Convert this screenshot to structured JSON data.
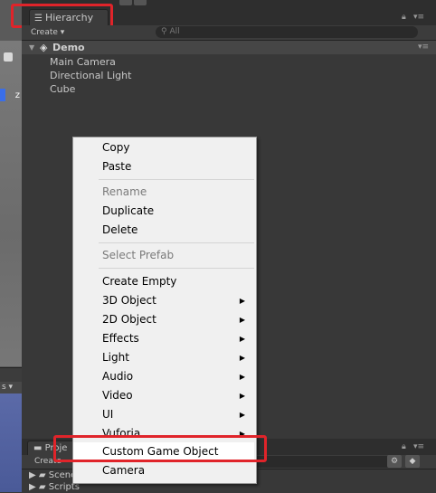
{
  "hierarchy": {
    "tab_label": "Hierarchy",
    "create_label": "Create ▾",
    "search_placeholder": "All",
    "scene_name": "Demo",
    "objects": [
      "Main Camera",
      "Directional Light",
      "Cube"
    ]
  },
  "scene_view": {
    "axis_label": "z",
    "side_label": "s ▾"
  },
  "context_menu": {
    "items": [
      {
        "label": "Copy",
        "enabled": true,
        "submenu": false
      },
      {
        "label": "Paste",
        "enabled": true,
        "submenu": false
      },
      {
        "label": "Rename",
        "enabled": false,
        "submenu": false
      },
      {
        "label": "Duplicate",
        "enabled": true,
        "submenu": false
      },
      {
        "label": "Delete",
        "enabled": true,
        "submenu": false
      },
      {
        "label": "Select Prefab",
        "enabled": false,
        "submenu": false
      },
      {
        "label": "Create Empty",
        "enabled": true,
        "submenu": false
      },
      {
        "label": "3D Object",
        "enabled": true,
        "submenu": true
      },
      {
        "label": "2D Object",
        "enabled": true,
        "submenu": true
      },
      {
        "label": "Effects",
        "enabled": true,
        "submenu": true
      },
      {
        "label": "Light",
        "enabled": true,
        "submenu": true
      },
      {
        "label": "Audio",
        "enabled": true,
        "submenu": true
      },
      {
        "label": "Video",
        "enabled": true,
        "submenu": true
      },
      {
        "label": "UI",
        "enabled": true,
        "submenu": true
      },
      {
        "label": "Vuforia",
        "enabled": true,
        "submenu": true
      },
      {
        "label": "Custom Game Object",
        "enabled": true,
        "submenu": false,
        "highlighted": true
      },
      {
        "label": "Camera",
        "enabled": true,
        "submenu": false
      }
    ]
  },
  "project": {
    "tab_label": "Proje",
    "create_label": "Create",
    "folders": [
      "Scene",
      "Scripts"
    ]
  },
  "colors": {
    "highlight_border": "#e0242a",
    "panel_bg": "#383838",
    "menu_bg": "#f0f0f0"
  }
}
